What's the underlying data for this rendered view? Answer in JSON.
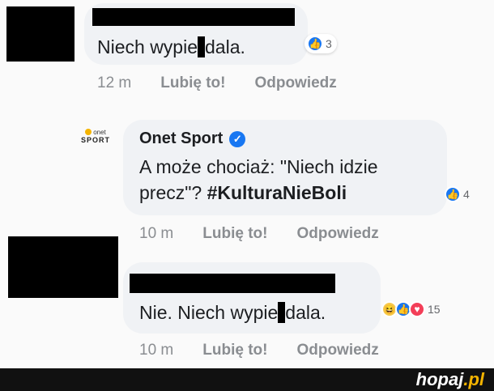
{
  "comments": [
    {
      "text_before": "Niech wypie",
      "text_after": "dala.",
      "reactions": [
        {
          "type": "like",
          "icon": "like-icon"
        }
      ],
      "reaction_count": "3",
      "time": "12 m",
      "like_label": "Lubię to!",
      "reply_label": "Odpowiedz"
    },
    {
      "author": "Onet Sport",
      "logo_top": "onet",
      "logo_bottom": "SPORT",
      "verified_glyph": "✓",
      "text_line1": "A może chociaż: \"Niech idzie",
      "text_line2_plain": "precz\"? ",
      "hashtag": "#KulturaNieBoli",
      "reactions": [
        {
          "type": "like",
          "icon": "like-icon"
        }
      ],
      "reaction_count": "4",
      "time": "10 m",
      "like_label": "Lubię to!",
      "reply_label": "Odpowiedz"
    },
    {
      "text_before": "Nie. Niech wypie",
      "text_after": "dala.",
      "reactions": [
        {
          "type": "haha",
          "icon": "haha-icon"
        },
        {
          "type": "like",
          "icon": "like-icon"
        },
        {
          "type": "love",
          "icon": "love-icon"
        }
      ],
      "reaction_count": "15",
      "time": "10 m",
      "like_label": "Lubię to!",
      "reply_label": "Odpowiedz"
    }
  ],
  "watermark": {
    "main": "hopaj",
    "suffix": ".pl"
  },
  "colors": {
    "accent": "#1877f2",
    "bubble": "#f0f2f5",
    "brand_accent": "#f5b400"
  }
}
